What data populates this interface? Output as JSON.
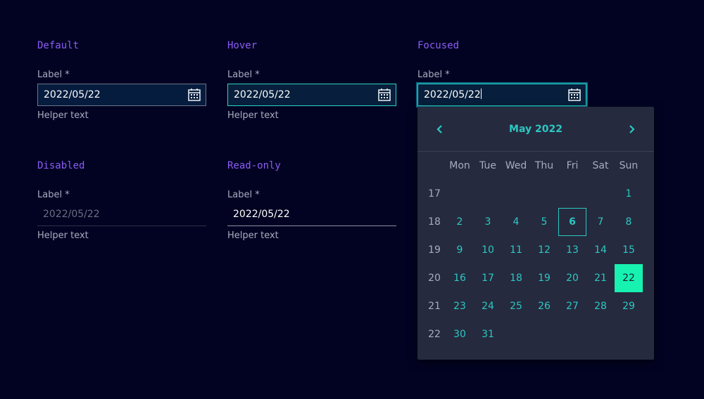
{
  "states": {
    "default": {
      "title": "Default",
      "label": "Label *",
      "value": "2022/05/22",
      "helper": "Helper text"
    },
    "hover": {
      "title": "Hover",
      "label": "Label *",
      "value": "2022/05/22",
      "helper": "Helper text"
    },
    "focused": {
      "title": "Focused",
      "label": "Label *",
      "value": "2022/05/22"
    },
    "disabled": {
      "title": "Disabled",
      "label": "Label *",
      "value": "2022/05/22",
      "helper": "Helper text"
    },
    "readonly": {
      "title": "Read-only",
      "label": "Label *",
      "value": "2022/05/22",
      "helper": "Helper text"
    }
  },
  "calendar": {
    "month_label": "May 2022",
    "weekdays": [
      "Mon",
      "Tue",
      "Wed",
      "Thu",
      "Fri",
      "Sat",
      "Sun"
    ],
    "weeks": [
      {
        "num": "17",
        "days": [
          "",
          "",
          "",
          "",
          "",
          "",
          "1"
        ]
      },
      {
        "num": "18",
        "days": [
          "2",
          "3",
          "4",
          "5",
          "6",
          "7",
          "8"
        ]
      },
      {
        "num": "19",
        "days": [
          "9",
          "10",
          "11",
          "12",
          "13",
          "14",
          "15"
        ]
      },
      {
        "num": "20",
        "days": [
          "16",
          "17",
          "18",
          "19",
          "20",
          "21",
          "22"
        ]
      },
      {
        "num": "21",
        "days": [
          "23",
          "24",
          "25",
          "26",
          "27",
          "28",
          "29"
        ]
      },
      {
        "num": "22",
        "days": [
          "30",
          "31",
          "",
          "",
          "",
          "",
          ""
        ]
      }
    ],
    "today": "6",
    "selected": "22"
  },
  "icons": {
    "field": "calendar-icon",
    "prev": "chevron-left-icon",
    "next": "chevron-right-icon"
  },
  "colors": {
    "background": "#020322",
    "accent": "#2cc7c2",
    "title": "#8b5cf6",
    "selected": "#17f2b0"
  }
}
